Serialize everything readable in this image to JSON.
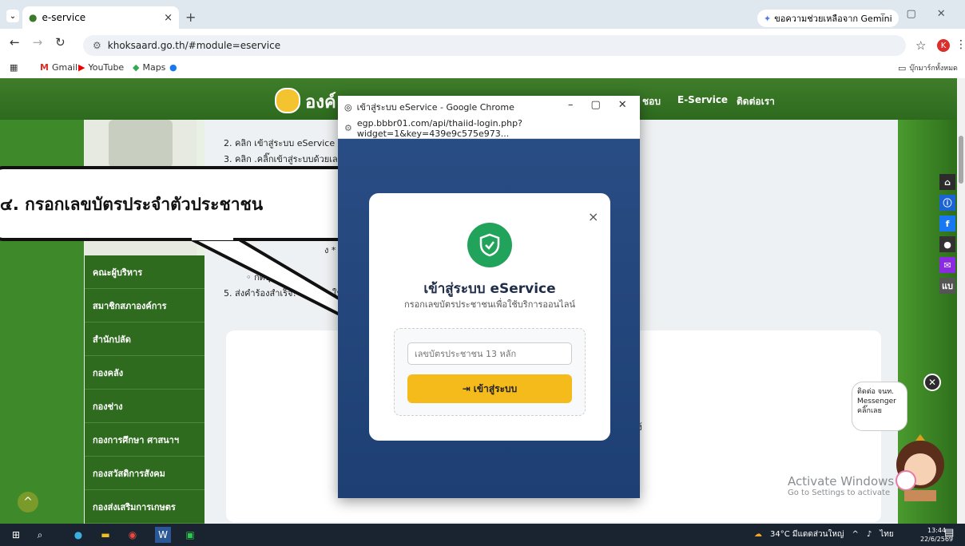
{
  "browser": {
    "tab_title": "e-service",
    "new_tab": "+",
    "gemini_label": "ขอความช่วยเหลือจาก Gemini",
    "url": "khoksaard.go.th/#module=eservice",
    "bookmarks": [
      "Gmail",
      "YouTube",
      "Maps"
    ],
    "all_bookmarks": "บุ๊กมาร์กทั้งหมด"
  },
  "site": {
    "org_name": "องค์",
    "nav": [
      "ชอบ",
      "E-Service",
      "ติดต่อเรา"
    ],
    "sidebar": [
      "คณะผู้บริหาร",
      "สมาชิกสภาองค์การ",
      "สำนักปลัด",
      "กองคลัง",
      "กองช่าง",
      "กองการศึกษา ศาสนาฯ",
      "กองสวัสดิการสังคม",
      "กองส่งเสริมการเกษตร"
    ],
    "steps": [
      "2. คลิก เข้าสู่ระบบ eService",
      "3. คลิก .คลิ๊กเข้าสู่ระบบด้วยเลขบัต",
      "ง *",
      "◦ แ",
      "◦ กดปุ่มส่งคำร",
      "5. ส่งคำร้องสำเร็จ! ระบบจะ ให้หม"
    ],
    "card_fragment": "ง้",
    "messenger": [
      "ติดต่อ จนท.",
      "Messenger",
      "คลิ๊กเลย"
    ],
    "side_label": "แบ"
  },
  "callout": {
    "text": "๔. กรอกเลขบัตรประจำตัวประชาชน"
  },
  "popup": {
    "window_title": "เข้าสู่ระบบ eService - Google Chrome",
    "url": "egp.bbbr01.com/api/thaiid-login.php?widget=1&key=439e9c575e973..."
  },
  "modal": {
    "title": "เข้าสู่ระบบ eService",
    "subtitle": "กรอกเลขบัตรประชาชนเพื่อใช้บริการออนไลน์",
    "input_placeholder": "เลขบัตรประชาชน 13 หลัก",
    "login_button": "เข้าสู่ระบบ",
    "close": "×"
  },
  "windows": {
    "activate_line1": "Activate Windows",
    "activate_line2": "Go to Settings to activate",
    "weather": "34°C มีแดดส่วนใหญ่",
    "lang": "ไทย",
    "time": "13:44",
    "date": "22/6/2569"
  }
}
